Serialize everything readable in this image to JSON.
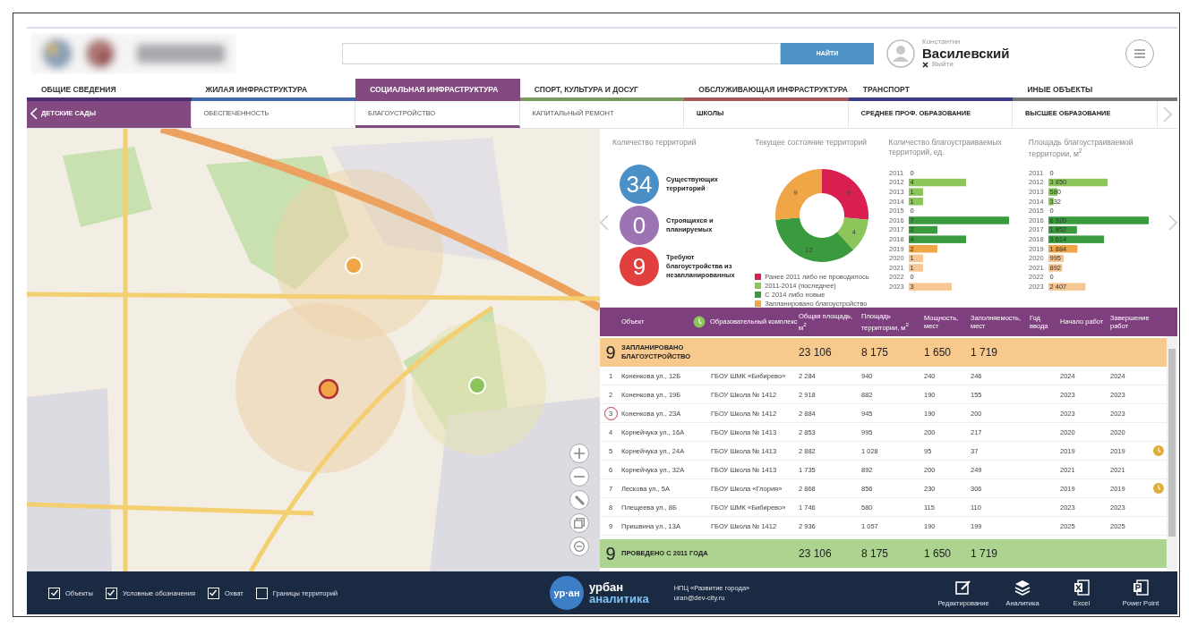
{
  "header": {
    "search": {
      "button": "НАЙТИ"
    },
    "user": {
      "first_name": "Константин",
      "last_name": "Василевский",
      "logout": "Выйти"
    }
  },
  "tabs": [
    {
      "label": "ОБЩИЕ СВЕДЕНИЯ",
      "selected": false,
      "color": "#4b2f6e"
    },
    {
      "label": "ЖИЛАЯ ИНФРАСТРУКТУРА",
      "selected": false,
      "color": "#4169b0"
    },
    {
      "label": "СОЦИАЛЬНАЯ ИНФРАСТРУКТУРА",
      "selected": true,
      "color": "#824a80"
    },
    {
      "label": "СПОРТ, КУЛЬТУРА И ДОСУГ",
      "selected": false,
      "color": "#789a5c"
    },
    {
      "label": "ОБСЛУЖИВАЮЩАЯ ИНФРАСТРУКТУРА",
      "selected": false,
      "color": "#a5575c"
    },
    {
      "label": "ТРАНСПОРТ",
      "selected": false,
      "color": "#3d3a88"
    },
    {
      "label": "ИНЫЕ ОБЪЕКТЫ",
      "selected": false,
      "color": "#777777"
    }
  ],
  "subtabs": [
    {
      "label": "ДЕТСКИЕ САДЫ",
      "kind": "current",
      "selected": false
    },
    {
      "label": "ОБЕСПЕЧЕННОСТЬ",
      "kind": "view",
      "selected": false
    },
    {
      "label": "БЛАГОУСТРОЙСТВО",
      "kind": "view",
      "selected": true
    },
    {
      "label": "КАПИТАЛЬНЫЙ РЕМОНТ",
      "kind": "view",
      "selected": false
    },
    {
      "label": "ШКОЛЫ",
      "kind": "category",
      "selected": false
    },
    {
      "label": "СРЕДНЕЕ ПРОФ. ОБРАЗОВАНИЕ",
      "kind": "category",
      "selected": false
    },
    {
      "label": "ВЫСШЕЕ ОБРАЗОВАНИЕ",
      "kind": "category",
      "selected": false
    }
  ],
  "stats": {
    "title": "Количество территорий",
    "items": [
      {
        "value": "34",
        "label": "Существующих территорий",
        "color": "#4a8fc6"
      },
      {
        "value": "0",
        "label": "Строящихся и планируемых",
        "color": "#9c74b4"
      },
      {
        "value": "9",
        "label": "Требуют благоустройства из незапланированных",
        "color": "#e2403f"
      }
    ]
  },
  "charts": [
    {
      "chart_data": {
        "type": "donut",
        "title": "Текущее состояние территорий",
        "data_labels": true,
        "categories": [
          "Ранее 2011 либо не проводилось",
          "2011-2014 (последнее)",
          "С 2014 либо новые",
          "Запланировано благоустройство"
        ],
        "values": [
          9,
          4,
          12,
          9
        ],
        "colors": [
          "#d91f4f",
          "#8cc65a",
          "#3a9a3e",
          "#f0a646"
        ]
      }
    },
    {
      "chart_data": {
        "type": "bar",
        "orientation": "horizontal",
        "data_labels": true,
        "title": "Количество благоустраиваемых территорий, ед.",
        "categories": [
          "2011",
          "2012",
          "2013",
          "2014",
          "2015",
          "2016",
          "2017",
          "2018",
          "2019",
          "2020",
          "2021",
          "2022",
          "2023"
        ],
        "values": [
          0,
          4,
          1,
          1,
          0,
          7,
          2,
          4,
          2,
          1,
          1,
          0,
          3
        ],
        "colors": [
          null,
          "#8cc65a",
          "#8cc65a",
          "#8cc65a",
          null,
          "#3a9a3e",
          "#3a9a3e",
          "#3a9a3e",
          "#f0a646",
          "#f6c792",
          "#f6c792",
          null,
          "#f6c792"
        ]
      }
    },
    {
      "chart_data": {
        "type": "bar",
        "orientation": "horizontal",
        "data_labels": true,
        "title": "Площадь благоустраиваемой территории, м$^{2}$",
        "categories": [
          "2011",
          "2012",
          "2013",
          "2014",
          "2015",
          "2016",
          "2017",
          "2018",
          "2019",
          "2020",
          "2021",
          "2022",
          "2023"
        ],
        "values": [
          0,
          3850,
          580,
          332,
          0,
          6520,
          1852,
          3614,
          1884,
          995,
          892,
          0,
          2407
        ],
        "colors": [
          null,
          "#8cc65a",
          "#8cc65a",
          "#8cc65a",
          null,
          "#3a9a3e",
          "#3a9a3e",
          "#3a9a3e",
          "#f0a646",
          "#f6c792",
          "#f6c792",
          null,
          "#f6c792"
        ]
      }
    }
  ],
  "table": {
    "columns": [
      "Объект",
      "Образовательный комплекс",
      "Общая площадь, м$^{2}$",
      "Площадь территории, м$^{2}$",
      "Мощность, мест",
      "Заполняемость, мест",
      "Год ввода",
      "Начало работ",
      "Завершение работ"
    ],
    "sections": [
      {
        "kind": "planned",
        "count": "9",
        "title": "ЗАПЛАНИРОВАНО БЛАГОУСТРОЙСТВО",
        "totals": {
          "area": "23 106",
          "territory": "8 175",
          "capacity": "1 650",
          "occupancy": "1 719"
        },
        "rows": [
          {
            "number": "1",
            "address": "Коненкова ул., 12Б",
            "complex": "ГБОУ ШМК «Бибирево»",
            "area": "2 284",
            "territory": "940",
            "capacity": "240",
            "occupancy": "246",
            "start": "2024",
            "end": "2024",
            "selected": false,
            "alert": false
          },
          {
            "number": "2",
            "address": "Коненкова ул., 19Б",
            "complex": "ГБОУ Школа № 1412",
            "area": "2 918",
            "territory": "882",
            "capacity": "190",
            "occupancy": "155",
            "start": "2023",
            "end": "2023",
            "selected": false,
            "alert": false
          },
          {
            "number": "3",
            "address": "Коненкова ул., 23А",
            "complex": "ГБОУ Школа № 1412",
            "area": "2 884",
            "territory": "945",
            "capacity": "190",
            "occupancy": "200",
            "start": "2023",
            "end": "2023",
            "selected": true,
            "alert": false
          },
          {
            "number": "4",
            "address": "Корнейчука ул., 16А",
            "complex": "ГБОУ Школа № 1413",
            "area": "2 853",
            "territory": "995",
            "capacity": "200",
            "occupancy": "217",
            "start": "2020",
            "end": "2020",
            "selected": false,
            "alert": false
          },
          {
            "number": "5",
            "address": "Корнейчука ул., 24А",
            "complex": "ГБОУ Школа № 1413",
            "area": "2 882",
            "territory": "1 028",
            "capacity": "95",
            "occupancy": "37",
            "start": "2019",
            "end": "2019",
            "selected": false,
            "alert": true
          },
          {
            "number": "6",
            "address": "Корнейчука ул., 32А",
            "complex": "ГБОУ Школа № 1413",
            "area": "1 735",
            "territory": "892",
            "capacity": "200",
            "occupancy": "249",
            "start": "2021",
            "end": "2021",
            "selected": false,
            "alert": false
          },
          {
            "number": "7",
            "address": "Лескова ул., 5А",
            "complex": "ГБОУ Школа «Глория»",
            "area": "2 868",
            "territory": "856",
            "capacity": "230",
            "occupancy": "306",
            "start": "2019",
            "end": "2019",
            "selected": false,
            "alert": true
          },
          {
            "number": "8",
            "address": "Плещеева ул., 8Б",
            "complex": "ГБОУ ШМК «Бибирево»",
            "area": "1 746",
            "territory": "580",
            "capacity": "115",
            "occupancy": "110",
            "start": "2023",
            "end": "2023",
            "selected": false,
            "alert": false
          },
          {
            "number": "9",
            "address": "Пришвина ул., 13А",
            "complex": "ГБОУ Школа № 1412",
            "area": "2 936",
            "territory": "1 057",
            "capacity": "190",
            "occupancy": "199",
            "start": "2025",
            "end": "2025",
            "selected": false,
            "alert": false
          }
        ]
      },
      {
        "kind": "done",
        "count": "9",
        "title": "ПРОВЕДЕНО С 2011 ГОДА",
        "totals": {
          "area": "23 106",
          "territory": "8 175",
          "capacity": "1 650",
          "occupancy": "1 719"
        }
      }
    ]
  },
  "footer": {
    "layers": [
      {
        "label": "Объекты",
        "checked": true
      },
      {
        "label": "Условные обозначения",
        "checked": true
      },
      {
        "label": "Охват",
        "checked": true
      },
      {
        "label": "Границы территорий",
        "checked": false
      }
    ],
    "logo": {
      "badge": "ур·ан",
      "title": "урбан",
      "subtitle": "аналитика"
    },
    "org": {
      "name": "НПЦ «Развитие города»",
      "email": "uran@dev-city.ru"
    },
    "tools": [
      {
        "kind": "edit",
        "label": "Редактирование"
      },
      {
        "kind": "layers",
        "label": "Аналитика"
      },
      {
        "kind": "excel",
        "label": "Excel"
      },
      {
        "kind": "powerpoint",
        "label": "Power Point"
      }
    ]
  }
}
